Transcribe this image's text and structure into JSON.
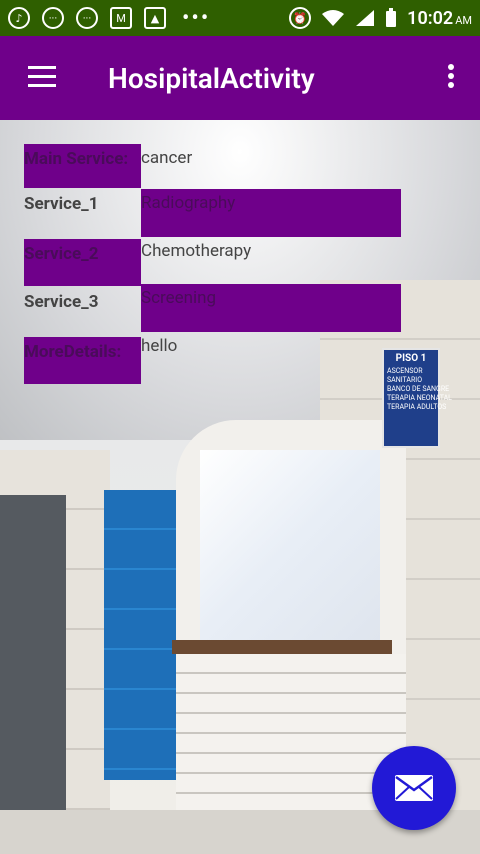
{
  "status_bar": {
    "time": "10:02",
    "ampm": "AM",
    "icons": [
      "music-note-icon",
      "chat-bubble-icon",
      "chat-bubble-icon",
      "gmail-icon",
      "image-icon",
      "more-dots-icon",
      "alarm-icon",
      "wifi-icon",
      "signal-icon",
      "battery-icon"
    ]
  },
  "app_bar": {
    "title": "HosipitalActivity"
  },
  "colors": {
    "status_bar": "#2f5f00",
    "app_bar": "#6f008a",
    "highlight": "#6f008a",
    "fab": "#2219d6"
  },
  "form": {
    "main_service_label": "Main Service:",
    "main_service_value": "cancer",
    "service1_label": "Service_1",
    "service1_value": "Radiography",
    "service2_label": "Service_2",
    "service2_value": "Chemotherapy",
    "service3_label": "Service_3",
    "service3_value": "Screening",
    "more_details_label": "MoreDetails:",
    "more_details_value": "hello"
  },
  "background_sign": {
    "title": "PISO 1",
    "lines": [
      "ASCENSOR",
      "SANITARIO",
      "BANCO DE SANGRE",
      "TERAPIA NEONATAL",
      "TERAPIA ADULTOS"
    ]
  },
  "fab": {
    "icon": "mail-icon"
  }
}
